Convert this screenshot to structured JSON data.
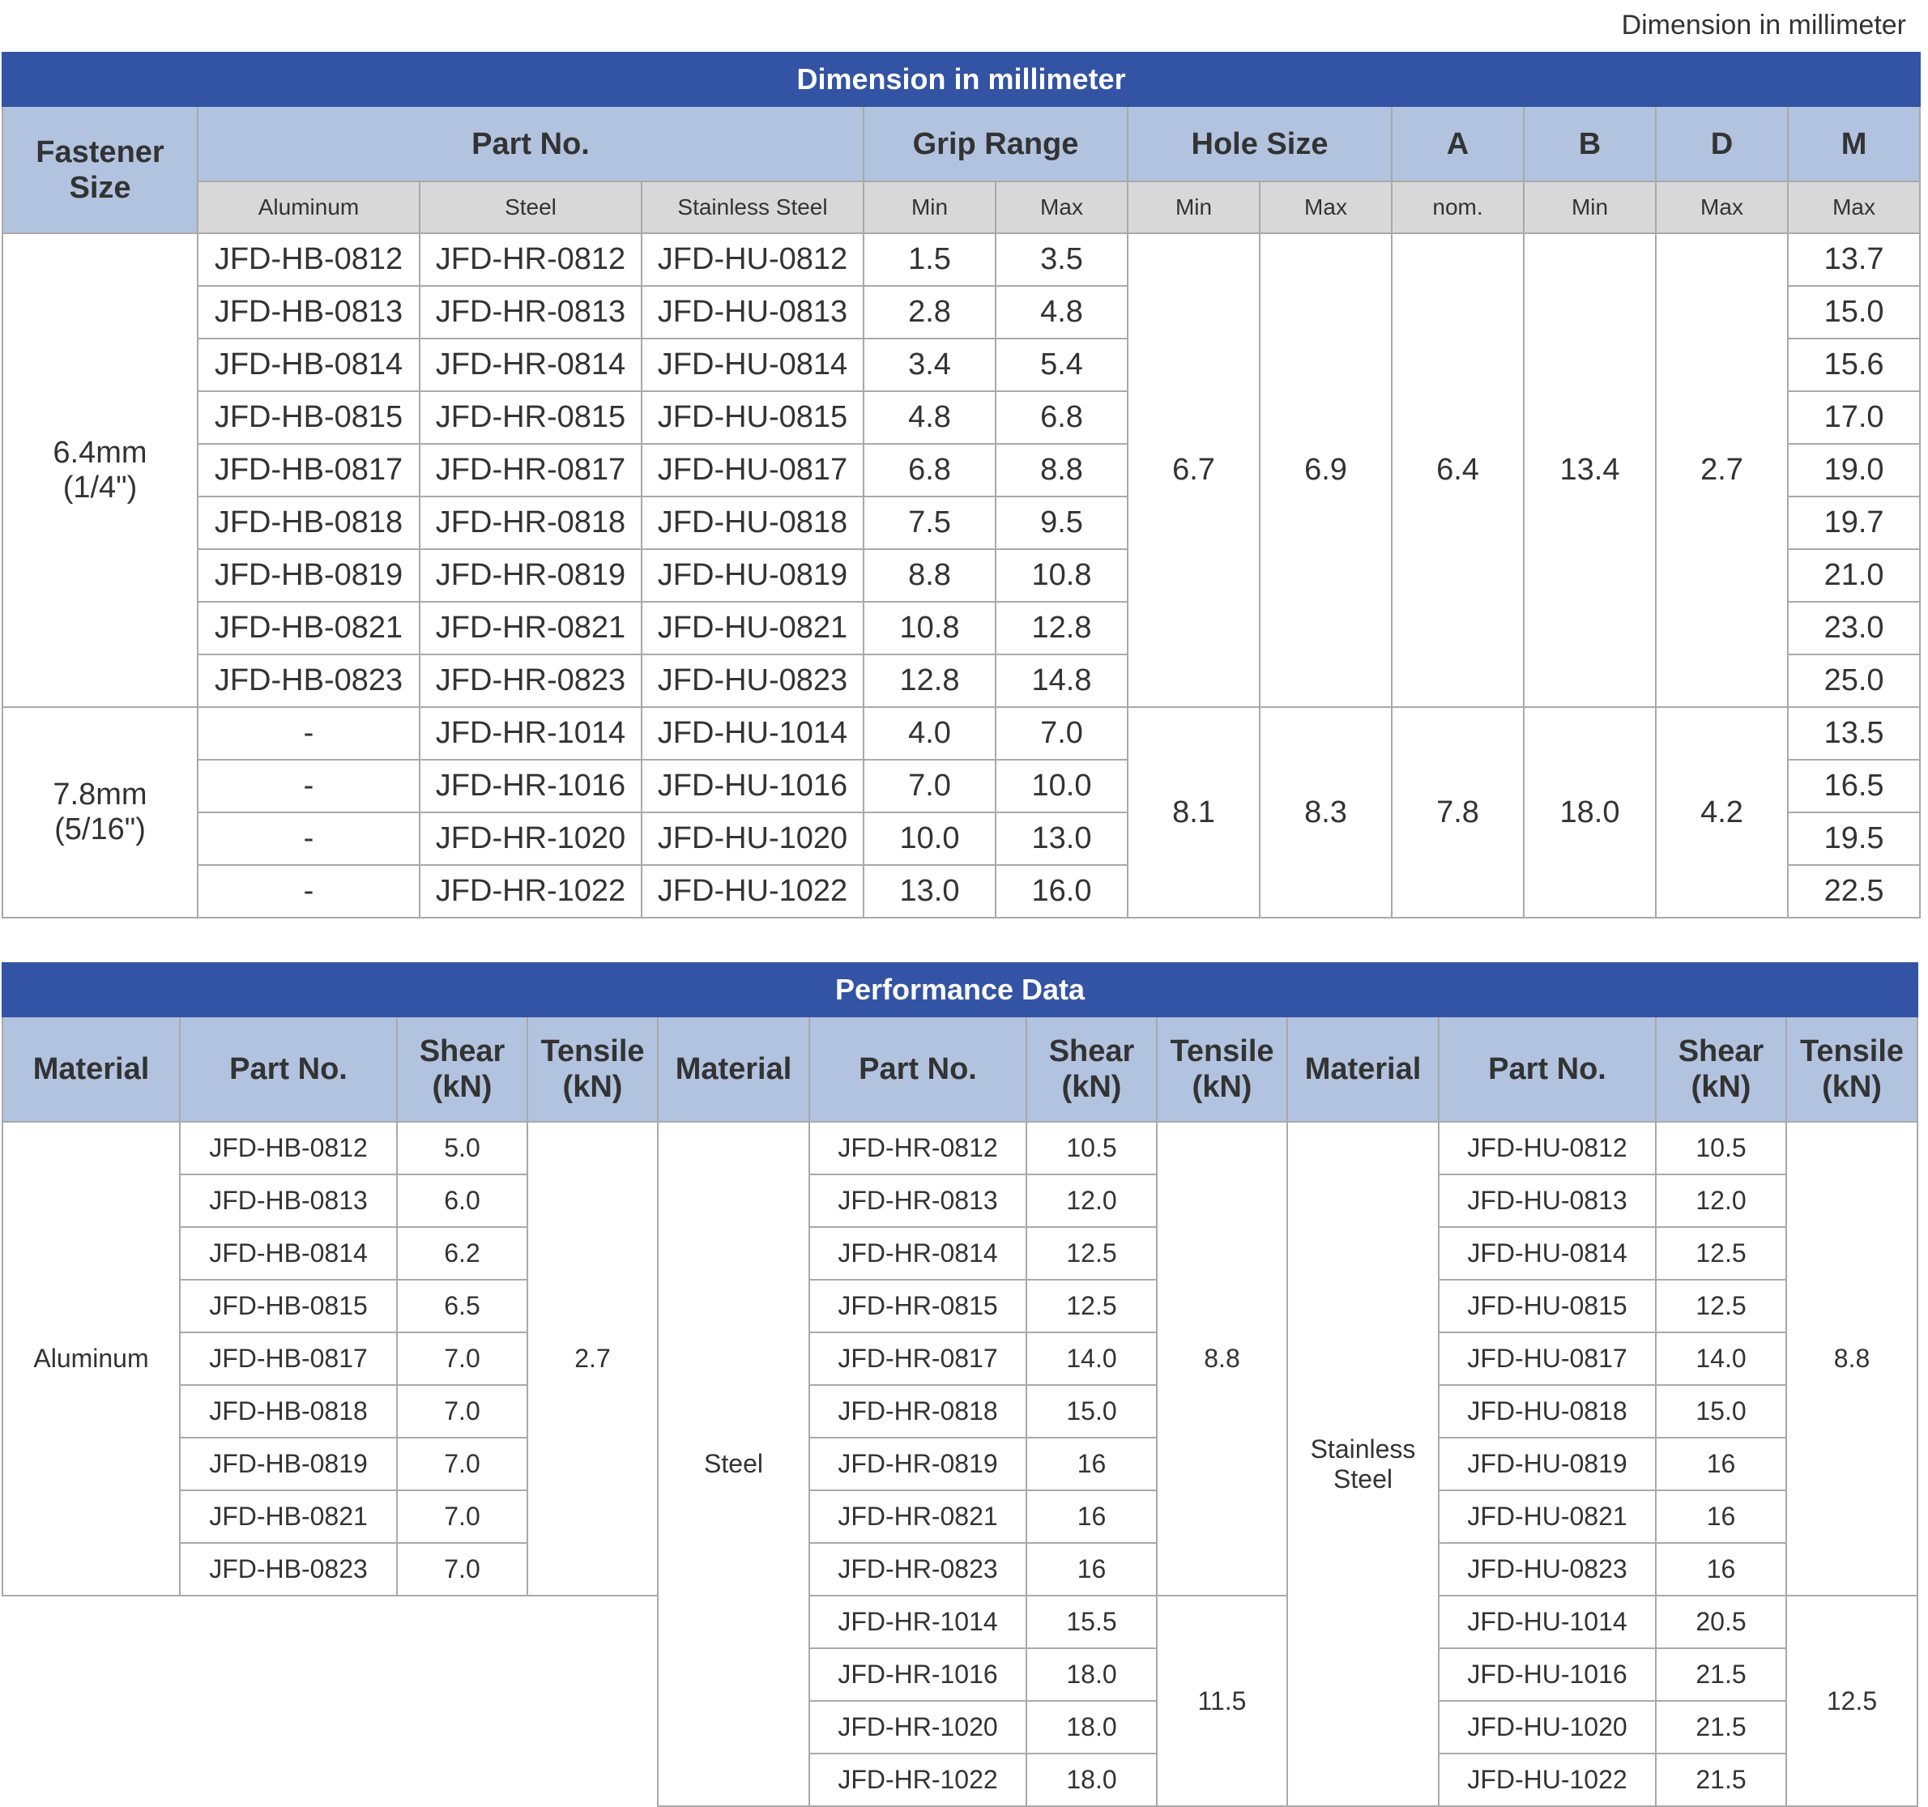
{
  "unit_note": "Dimension in millimeter",
  "dimension_table": {
    "title": "Dimension in millimeter",
    "headers": {
      "fastener_size": "Fastener\nSize",
      "part_no": "Part No.",
      "grip_range": "Grip Range",
      "hole_size": "Hole Size",
      "a": "A",
      "b": "B",
      "d": "D",
      "m": "M"
    },
    "subheaders": {
      "aluminum": "Aluminum",
      "steel": "Steel",
      "stainless_steel": "Stainless Steel",
      "grip_min": "Min",
      "grip_max": "Max",
      "hole_min": "Min",
      "hole_max": "Max",
      "a_nom": "nom.",
      "b_min": "Min",
      "d_max": "Max",
      "m_max": "Max"
    },
    "groups": [
      {
        "size": "6.4mm\n(1/4\")",
        "hole_min": "6.7",
        "hole_max": "6.9",
        "a": "6.4",
        "b": "13.4",
        "d": "2.7",
        "rows": [
          {
            "aluminum": "JFD-HB-0812",
            "steel": "JFD-HR-0812",
            "stainless": "JFD-HU-0812",
            "grip_min": "1.5",
            "grip_max": "3.5",
            "m": "13.7"
          },
          {
            "aluminum": "JFD-HB-0813",
            "steel": "JFD-HR-0813",
            "stainless": "JFD-HU-0813",
            "grip_min": "2.8",
            "grip_max": "4.8",
            "m": "15.0"
          },
          {
            "aluminum": "JFD-HB-0814",
            "steel": "JFD-HR-0814",
            "stainless": "JFD-HU-0814",
            "grip_min": "3.4",
            "grip_max": "5.4",
            "m": "15.6"
          },
          {
            "aluminum": "JFD-HB-0815",
            "steel": "JFD-HR-0815",
            "stainless": "JFD-HU-0815",
            "grip_min": "4.8",
            "grip_max": "6.8",
            "m": "17.0"
          },
          {
            "aluminum": "JFD-HB-0817",
            "steel": "JFD-HR-0817",
            "stainless": "JFD-HU-0817",
            "grip_min": "6.8",
            "grip_max": "8.8",
            "m": "19.0"
          },
          {
            "aluminum": "JFD-HB-0818",
            "steel": "JFD-HR-0818",
            "stainless": "JFD-HU-0818",
            "grip_min": "7.5",
            "grip_max": "9.5",
            "m": "19.7"
          },
          {
            "aluminum": "JFD-HB-0819",
            "steel": "JFD-HR-0819",
            "stainless": "JFD-HU-0819",
            "grip_min": "8.8",
            "grip_max": "10.8",
            "m": "21.0"
          },
          {
            "aluminum": "JFD-HB-0821",
            "steel": "JFD-HR-0821",
            "stainless": "JFD-HU-0821",
            "grip_min": "10.8",
            "grip_max": "12.8",
            "m": "23.0"
          },
          {
            "aluminum": "JFD-HB-0823",
            "steel": "JFD-HR-0823",
            "stainless": "JFD-HU-0823",
            "grip_min": "12.8",
            "grip_max": "14.8",
            "m": "25.0"
          }
        ]
      },
      {
        "size": "7.8mm\n(5/16\")",
        "hole_min": "8.1",
        "hole_max": "8.3",
        "a": "7.8",
        "b": "18.0",
        "d": "4.2",
        "rows": [
          {
            "aluminum": "-",
            "steel": "JFD-HR-1014",
            "stainless": "JFD-HU-1014",
            "grip_min": "4.0",
            "grip_max": "7.0",
            "m": "13.5"
          },
          {
            "aluminum": "-",
            "steel": "JFD-HR-1016",
            "stainless": "JFD-HU-1016",
            "grip_min": "7.0",
            "grip_max": "10.0",
            "m": "16.5"
          },
          {
            "aluminum": "-",
            "steel": "JFD-HR-1020",
            "stainless": "JFD-HU-1020",
            "grip_min": "10.0",
            "grip_max": "13.0",
            "m": "19.5"
          },
          {
            "aluminum": "-",
            "steel": "JFD-HR-1022",
            "stainless": "JFD-HU-1022",
            "grip_min": "13.0",
            "grip_max": "16.0",
            "m": "22.5"
          }
        ]
      }
    ]
  },
  "performance_table": {
    "title": "Performance Data",
    "headers": {
      "material": "Material",
      "part_no": "Part No.",
      "shear": "Shear\n(kN)",
      "tensile": "Tensile\n(kN)"
    },
    "aluminum": {
      "material": "Aluminum",
      "tensile": "2.7",
      "rows": [
        {
          "part": "JFD-HB-0812",
          "shear": "5.0"
        },
        {
          "part": "JFD-HB-0813",
          "shear": "6.0"
        },
        {
          "part": "JFD-HB-0814",
          "shear": "6.2"
        },
        {
          "part": "JFD-HB-0815",
          "shear": "6.5"
        },
        {
          "part": "JFD-HB-0817",
          "shear": "7.0"
        },
        {
          "part": "JFD-HB-0818",
          "shear": "7.0"
        },
        {
          "part": "JFD-HB-0819",
          "shear": "7.0"
        },
        {
          "part": "JFD-HB-0821",
          "shear": "7.0"
        },
        {
          "part": "JFD-HB-0823",
          "shear": "7.0"
        }
      ]
    },
    "steel": {
      "material": "Steel",
      "tensile_a": "8.8",
      "tensile_b": "11.5",
      "rows": [
        {
          "part": "JFD-HR-0812",
          "shear": "10.5"
        },
        {
          "part": "JFD-HR-0813",
          "shear": "12.0"
        },
        {
          "part": "JFD-HR-0814",
          "shear": "12.5"
        },
        {
          "part": "JFD-HR-0815",
          "shear": "12.5"
        },
        {
          "part": "JFD-HR-0817",
          "shear": "14.0"
        },
        {
          "part": "JFD-HR-0818",
          "shear": "15.0"
        },
        {
          "part": "JFD-HR-0819",
          "shear": "16"
        },
        {
          "part": "JFD-HR-0821",
          "shear": "16"
        },
        {
          "part": "JFD-HR-0823",
          "shear": "16"
        },
        {
          "part": "JFD-HR-1014",
          "shear": "15.5"
        },
        {
          "part": "JFD-HR-1016",
          "shear": "18.0"
        },
        {
          "part": "JFD-HR-1020",
          "shear": "18.0"
        },
        {
          "part": "JFD-HR-1022",
          "shear": "18.0"
        }
      ]
    },
    "stainless": {
      "material": "Stainless\nSteel",
      "tensile_a": "8.8",
      "tensile_b": "12.5",
      "rows": [
        {
          "part": "JFD-HU-0812",
          "shear": "10.5"
        },
        {
          "part": "JFD-HU-0813",
          "shear": "12.0"
        },
        {
          "part": "JFD-HU-0814",
          "shear": "12.5"
        },
        {
          "part": "JFD-HU-0815",
          "shear": "12.5"
        },
        {
          "part": "JFD-HU-0817",
          "shear": "14.0"
        },
        {
          "part": "JFD-HU-0818",
          "shear": "15.0"
        },
        {
          "part": "JFD-HU-0819",
          "shear": "16"
        },
        {
          "part": "JFD-HU-0821",
          "shear": "16"
        },
        {
          "part": "JFD-HU-0823",
          "shear": "16"
        },
        {
          "part": "JFD-HU-1014",
          "shear": "20.5"
        },
        {
          "part": "JFD-HU-1016",
          "shear": "21.5"
        },
        {
          "part": "JFD-HU-1020",
          "shear": "21.5"
        },
        {
          "part": "JFD-HU-1022",
          "shear": "21.5"
        }
      ]
    }
  }
}
